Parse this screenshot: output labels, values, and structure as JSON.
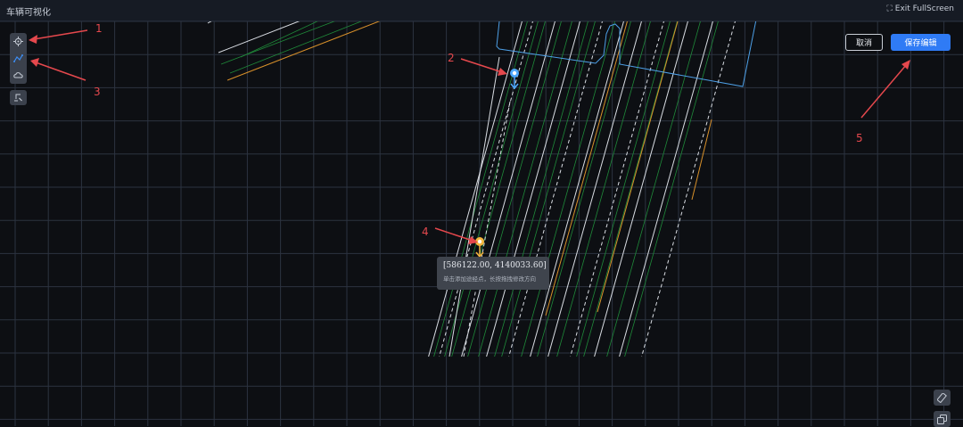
{
  "window": {
    "title": "车辆可视化",
    "exit_fullscreen_label": "Exit FullScreen",
    "exit_icon": "compress-arrows-icon"
  },
  "toolbar": {
    "tools": [
      {
        "name": "locate-point",
        "icon": "crosshair-icon"
      },
      {
        "name": "draw-path",
        "icon": "path-icon",
        "active": true
      },
      {
        "name": "draw-region",
        "icon": "cloud-shape-icon"
      }
    ],
    "extra_tool_icon": "route-edit-icon"
  },
  "actions": {
    "cancel_label": "取消",
    "save_label": "保存编辑"
  },
  "markers": {
    "start_color": "#4ea8ff",
    "end_color": "#f5b53d"
  },
  "tooltip": {
    "coordinate": "[586122.00, 4140033.60]",
    "hint": "单击添加途经点，长按拖拽修改方向"
  },
  "annotations": [
    "1",
    "2",
    "3",
    "4",
    "5"
  ],
  "bottom_controls": [
    {
      "name": "ruler",
      "icon": "ruler-icon"
    },
    {
      "name": "layers",
      "icon": "copy-layers-icon"
    }
  ],
  "colors": {
    "background": "#0d0f13",
    "grid": "#2c3340",
    "lane_white": "#d9dde3",
    "lane_green": "#1f8a3a",
    "lane_orange": "#d8902a",
    "boundary_blue": "#4d9fe6",
    "accent": "#2f7bf5",
    "annotation_red": "#e5484d"
  }
}
